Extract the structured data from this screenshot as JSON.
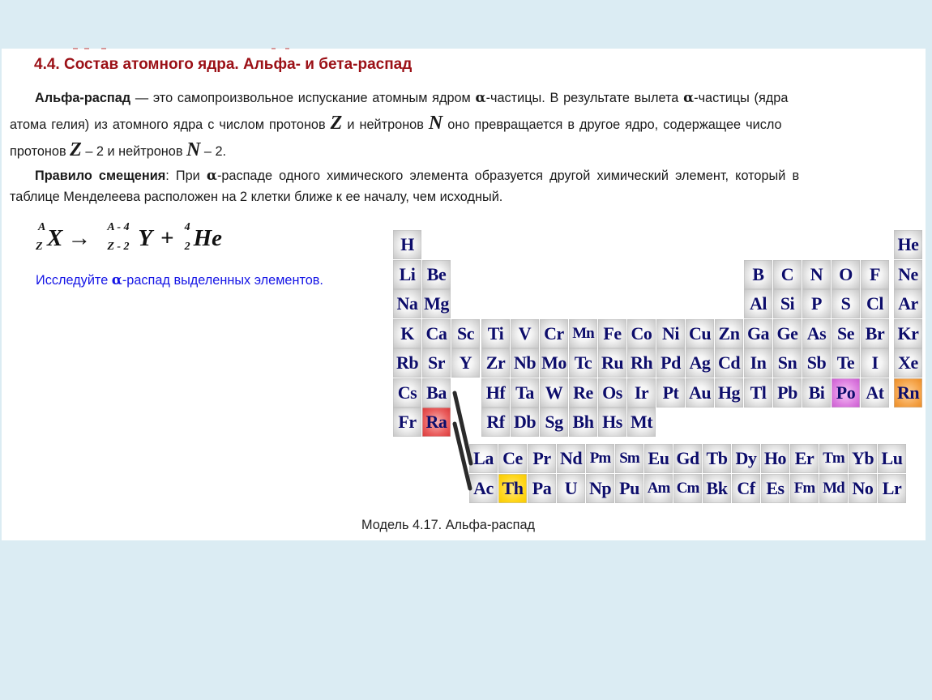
{
  "section": {
    "title": "4.4. Состав атомного ядра. Альфа- и бета-распад"
  },
  "paragraph1": {
    "term": "Альфа-распад",
    "l1_a": " — это самопроизвольное испускание атомным ядром ",
    "alpha": "α",
    "l1_b": "-частицы. В результате вылета ",
    "l1_c": "-частицы (ядра",
    "l2_a": "атома гелия) из атомного ядра с числом протонов ",
    "Z": "Z",
    "l2_b": " и нейтронов ",
    "N": "N",
    "l2_c": " оно превращается в другое ядро, содержащее число",
    "l3_a": "протонов ",
    "l3_b": " – 2 и нейтронов ",
    "l3_c": " – 2."
  },
  "paragraph2": {
    "term": "Правило смещения",
    "l1_a": ": При ",
    "alpha": "α",
    "l1_b": "-распаде одного химического элемента образуется другой химический элемент, который в",
    "l2": "таблице Менделеева расположен на 2 клетки ближе к ее началу, чем исходный."
  },
  "formula": {
    "parent": {
      "A": "A",
      "Z": "Z",
      "symbol": "X"
    },
    "arrow": "→",
    "daughter": {
      "A": "A - 4",
      "Z": "Z - 2",
      "symbol": "Y"
    },
    "plus": "+",
    "helium": {
      "A": "4",
      "Z": "2",
      "symbol": "He"
    }
  },
  "hint": {
    "a": "Исследуйте ",
    "alpha": "α",
    "b": "-распад выделенных элементов."
  },
  "highlight_colors": {
    "red": "#e34a4a",
    "yellow": "#ffd61a",
    "violet": "#d66fda",
    "orange": "#f09a3a"
  },
  "periodic_table": {
    "main": [
      {
        "symbol": "H",
        "row": 1,
        "col": 1
      },
      {
        "symbol": "He",
        "row": 1,
        "col": 18
      },
      {
        "symbol": "Li",
        "row": 2,
        "col": 1
      },
      {
        "symbol": "Be",
        "row": 2,
        "col": 2
      },
      {
        "symbol": "B",
        "row": 2,
        "col": 13
      },
      {
        "symbol": "C",
        "row": 2,
        "col": 14
      },
      {
        "symbol": "N",
        "row": 2,
        "col": 15
      },
      {
        "symbol": "O",
        "row": 2,
        "col": 16
      },
      {
        "symbol": "F",
        "row": 2,
        "col": 17
      },
      {
        "symbol": "Ne",
        "row": 2,
        "col": 18
      },
      {
        "symbol": "Na",
        "row": 3,
        "col": 1
      },
      {
        "symbol": "Mg",
        "row": 3,
        "col": 2
      },
      {
        "symbol": "Al",
        "row": 3,
        "col": 13
      },
      {
        "symbol": "Si",
        "row": 3,
        "col": 14
      },
      {
        "symbol": "P",
        "row": 3,
        "col": 15
      },
      {
        "symbol": "S",
        "row": 3,
        "col": 16
      },
      {
        "symbol": "Cl",
        "row": 3,
        "col": 17
      },
      {
        "symbol": "Ar",
        "row": 3,
        "col": 18
      },
      {
        "symbol": "K",
        "row": 4,
        "col": 1
      },
      {
        "symbol": "Ca",
        "row": 4,
        "col": 2
      },
      {
        "symbol": "Sc",
        "row": 4,
        "col": 3
      },
      {
        "symbol": "Ti",
        "row": 4,
        "col": 4
      },
      {
        "symbol": "V",
        "row": 4,
        "col": 5
      },
      {
        "symbol": "Cr",
        "row": 4,
        "col": 6
      },
      {
        "symbol": "Mn",
        "row": 4,
        "col": 7
      },
      {
        "symbol": "Fe",
        "row": 4,
        "col": 8
      },
      {
        "symbol": "Co",
        "row": 4,
        "col": 9
      },
      {
        "symbol": "Ni",
        "row": 4,
        "col": 10
      },
      {
        "symbol": "Cu",
        "row": 4,
        "col": 11
      },
      {
        "symbol": "Zn",
        "row": 4,
        "col": 12
      },
      {
        "symbol": "Ga",
        "row": 4,
        "col": 13
      },
      {
        "symbol": "Ge",
        "row": 4,
        "col": 14
      },
      {
        "symbol": "As",
        "row": 4,
        "col": 15
      },
      {
        "symbol": "Se",
        "row": 4,
        "col": 16
      },
      {
        "symbol": "Br",
        "row": 4,
        "col": 17
      },
      {
        "symbol": "Kr",
        "row": 4,
        "col": 18
      },
      {
        "symbol": "Rb",
        "row": 5,
        "col": 1
      },
      {
        "symbol": "Sr",
        "row": 5,
        "col": 2
      },
      {
        "symbol": "Y",
        "row": 5,
        "col": 3
      },
      {
        "symbol": "Zr",
        "row": 5,
        "col": 4
      },
      {
        "symbol": "Nb",
        "row": 5,
        "col": 5
      },
      {
        "symbol": "Mo",
        "row": 5,
        "col": 6
      },
      {
        "symbol": "Tc",
        "row": 5,
        "col": 7
      },
      {
        "symbol": "Ru",
        "row": 5,
        "col": 8
      },
      {
        "symbol": "Rh",
        "row": 5,
        "col": 9
      },
      {
        "symbol": "Pd",
        "row": 5,
        "col": 10
      },
      {
        "symbol": "Ag",
        "row": 5,
        "col": 11
      },
      {
        "symbol": "Cd",
        "row": 5,
        "col": 12
      },
      {
        "symbol": "In",
        "row": 5,
        "col": 13
      },
      {
        "symbol": "Sn",
        "row": 5,
        "col": 14
      },
      {
        "symbol": "Sb",
        "row": 5,
        "col": 15
      },
      {
        "symbol": "Te",
        "row": 5,
        "col": 16
      },
      {
        "symbol": "I",
        "row": 5,
        "col": 17
      },
      {
        "symbol": "Xe",
        "row": 5,
        "col": 18
      },
      {
        "symbol": "Cs",
        "row": 6,
        "col": 1
      },
      {
        "symbol": "Ba",
        "row": 6,
        "col": 2
      },
      {
        "symbol": "Hf",
        "row": 6,
        "col": 4
      },
      {
        "symbol": "Ta",
        "row": 6,
        "col": 5
      },
      {
        "symbol": "W",
        "row": 6,
        "col": 6
      },
      {
        "symbol": "Re",
        "row": 6,
        "col": 7
      },
      {
        "symbol": "Os",
        "row": 6,
        "col": 8
      },
      {
        "symbol": "Ir",
        "row": 6,
        "col": 9
      },
      {
        "symbol": "Pt",
        "row": 6,
        "col": 10
      },
      {
        "symbol": "Au",
        "row": 6,
        "col": 11
      },
      {
        "symbol": "Hg",
        "row": 6,
        "col": 12
      },
      {
        "symbol": "Tl",
        "row": 6,
        "col": 13
      },
      {
        "symbol": "Pb",
        "row": 6,
        "col": 14
      },
      {
        "symbol": "Bi",
        "row": 6,
        "col": 15
      },
      {
        "symbol": "Po",
        "row": 6,
        "col": 16,
        "highlight": "violet"
      },
      {
        "symbol": "At",
        "row": 6,
        "col": 17
      },
      {
        "symbol": "Rn",
        "row": 6,
        "col": 18,
        "highlight": "orange"
      },
      {
        "symbol": "Fr",
        "row": 7,
        "col": 1
      },
      {
        "symbol": "Ra",
        "row": 7,
        "col": 2,
        "highlight": "red"
      },
      {
        "symbol": "Rf",
        "row": 7,
        "col": 4
      },
      {
        "symbol": "Db",
        "row": 7,
        "col": 5
      },
      {
        "symbol": "Sg",
        "row": 7,
        "col": 6
      },
      {
        "symbol": "Bh",
        "row": 7,
        "col": 7
      },
      {
        "symbol": "Hs",
        "row": 7,
        "col": 8
      },
      {
        "symbol": "Mt",
        "row": 7,
        "col": 9
      }
    ],
    "lanthanides": [
      "La",
      "Ce",
      "Pr",
      "Nd",
      "Pm",
      "Sm",
      "Eu",
      "Gd",
      "Tb",
      "Dy",
      "Ho",
      "Er",
      "Tm",
      "Yb",
      "Lu"
    ],
    "actinides": [
      "Ac",
      "Th",
      "Pa",
      "U",
      "Np",
      "Pu",
      "Am",
      "Cm",
      "Bk",
      "Cf",
      "Es",
      "Fm",
      "Md",
      "No",
      "Lr"
    ],
    "actinide_highlights": {
      "Th": "yellow"
    }
  },
  "caption": "Модель 4.17. Альфа-распад"
}
